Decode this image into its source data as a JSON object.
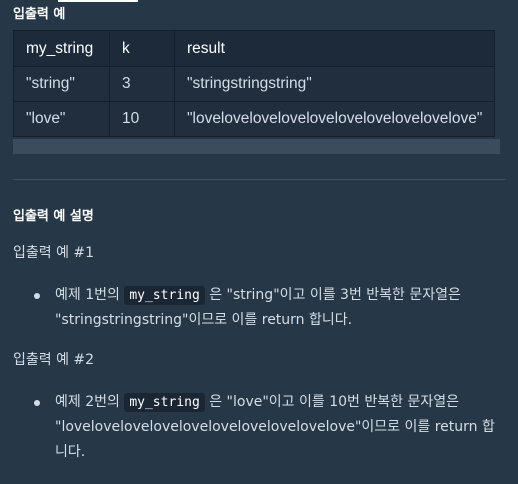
{
  "examples_heading": "입출력 예",
  "table": {
    "headers": [
      "my_string",
      "k",
      "result"
    ],
    "rows": [
      [
        "\"string\"",
        "3",
        "\"stringstringstring\""
      ],
      [
        "\"love\"",
        "10",
        "\"lovelovelovelovelovelovelovelovelovelove\""
      ]
    ]
  },
  "explain_heading": "입출력 예 설명",
  "examples": [
    {
      "title": "입출력 예 #1",
      "before_code": "예제 1번의 ",
      "code": "my_string",
      "after_code": " 은 \"string\"이고 이를 3번 반복한 문자열은 \"stringstringstring\"이므로 이를 return 합니다."
    },
    {
      "title": "입출력 예 #2",
      "before_code": "예제 2번의 ",
      "code": "my_string",
      "after_code": " 은 \"love\"이고 이를 10번 반복한 문자열은 \"lovelovelovelovelovelovelovelovelovelove\"이므로 이를 return 합니다."
    }
  ]
}
